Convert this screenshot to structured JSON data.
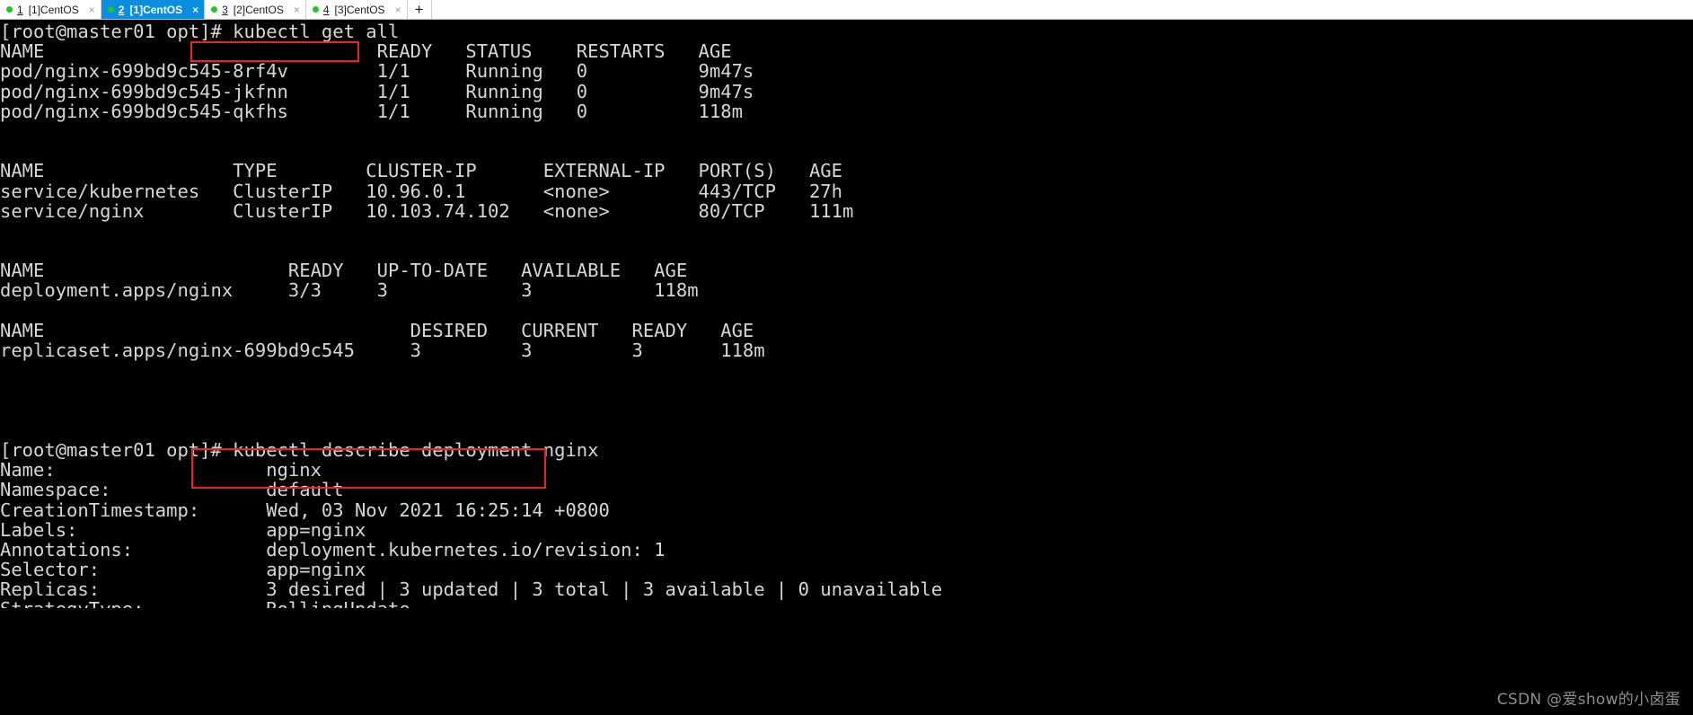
{
  "tabbar": {
    "tabs": [
      {
        "num": "1",
        "label": "[1]CentOS",
        "active": false,
        "close": "×",
        "status": "connected"
      },
      {
        "num": "2",
        "label": "[1]CentOS",
        "active": true,
        "close": "×",
        "status": "connected"
      },
      {
        "num": "3",
        "label": "[2]CentOS",
        "active": false,
        "close": "×",
        "status": "connected"
      },
      {
        "num": "4",
        "label": "[3]CentOS",
        "active": false,
        "close": "×",
        "status": "connected"
      }
    ],
    "new_tab_label": "+"
  },
  "terminal": {
    "prompt": "[root@master01 opt]#",
    "commands": {
      "get_all": "kubectl get all",
      "describe": "kubectl describe deployment nginx"
    },
    "lines": [
      "[root@master01 opt]# kubectl get all",
      "NAME                              READY   STATUS    RESTARTS   AGE",
      "pod/nginx-699bd9c545-8rf4v        1/1     Running   0          9m47s",
      "pod/nginx-699bd9c545-jkfnn        1/1     Running   0          9m47s",
      "pod/nginx-699bd9c545-qkfhs        1/1     Running   0          118m",
      "",
      "",
      "NAME                 TYPE        CLUSTER-IP      EXTERNAL-IP   PORT(S)   AGE",
      "service/kubernetes   ClusterIP   10.96.0.1       <none>        443/TCP   27h",
      "service/nginx        ClusterIP   10.103.74.102   <none>        80/TCP    111m",
      "",
      "",
      "NAME                      READY   UP-TO-DATE   AVAILABLE   AGE",
      "deployment.apps/nginx     3/3     3            3           118m",
      "",
      "NAME                                 DESIRED   CURRENT   READY   AGE",
      "replicaset.apps/nginx-699bd9c545     3         3         3       118m",
      "",
      "",
      "",
      "",
      "[root@master01 opt]# kubectl describe deployment nginx",
      "Name:                   nginx",
      "Namespace:              default",
      "CreationTimestamp:      Wed, 03 Nov 2021 16:25:14 +0800",
      "Labels:                 app=nginx",
      "Annotations:            deployment.kubernetes.io/revision: 1",
      "Selector:               app=nginx",
      "Replicas:               3 desired | 3 updated | 3 total | 3 available | 0 unavailable",
      "StrategyType:           RollingUpdate"
    ],
    "pods_table": {
      "type": "table",
      "headers": [
        "NAME",
        "READY",
        "STATUS",
        "RESTARTS",
        "AGE"
      ],
      "rows": [
        [
          "pod/nginx-699bd9c545-8rf4v",
          "1/1",
          "Running",
          "0",
          "9m47s"
        ],
        [
          "pod/nginx-699bd9c545-jkfnn",
          "1/1",
          "Running",
          "0",
          "9m47s"
        ],
        [
          "pod/nginx-699bd9c545-qkfhs",
          "1/1",
          "Running",
          "0",
          "118m"
        ]
      ]
    },
    "services_table": {
      "type": "table",
      "headers": [
        "NAME",
        "TYPE",
        "CLUSTER-IP",
        "EXTERNAL-IP",
        "PORT(S)",
        "AGE"
      ],
      "rows": [
        [
          "service/kubernetes",
          "ClusterIP",
          "10.96.0.1",
          "<none>",
          "443/TCP",
          "27h"
        ],
        [
          "service/nginx",
          "ClusterIP",
          "10.103.74.102",
          "<none>",
          "80/TCP",
          "111m"
        ]
      ]
    },
    "deployments_table": {
      "type": "table",
      "headers": [
        "NAME",
        "READY",
        "UP-TO-DATE",
        "AVAILABLE",
        "AGE"
      ],
      "rows": [
        [
          "deployment.apps/nginx",
          "3/3",
          "3",
          "3",
          "118m"
        ]
      ]
    },
    "replicasets_table": {
      "type": "table",
      "headers": [
        "NAME",
        "DESIRED",
        "CURRENT",
        "READY",
        "AGE"
      ],
      "rows": [
        [
          "replicaset.apps/nginx-699bd9c545",
          "3",
          "3",
          "3",
          "118m"
        ]
      ]
    },
    "describe_fields": [
      {
        "key": "Name:",
        "value": "nginx"
      },
      {
        "key": "Namespace:",
        "value": "default"
      },
      {
        "key": "CreationTimestamp:",
        "value": "Wed, 03 Nov 2021 16:25:14 +0800"
      },
      {
        "key": "Labels:",
        "value": "app=nginx"
      },
      {
        "key": "Annotations:",
        "value": "deployment.kubernetes.io/revision: 1"
      },
      {
        "key": "Selector:",
        "value": "app=nginx"
      },
      {
        "key": "Replicas:",
        "value": "3 desired | 3 updated | 3 total | 3 available | 0 unavailable"
      },
      {
        "key": "StrategyType:",
        "value": "RollingUpdate"
      }
    ]
  },
  "watermark": "CSDN @爱show的小卤蛋",
  "colors": {
    "background": "#000000",
    "foreground": "#d6d6d6",
    "active_tab": "#0a8fe0",
    "highlight_box": "#ee2222",
    "status_dot": "#23c423"
  }
}
